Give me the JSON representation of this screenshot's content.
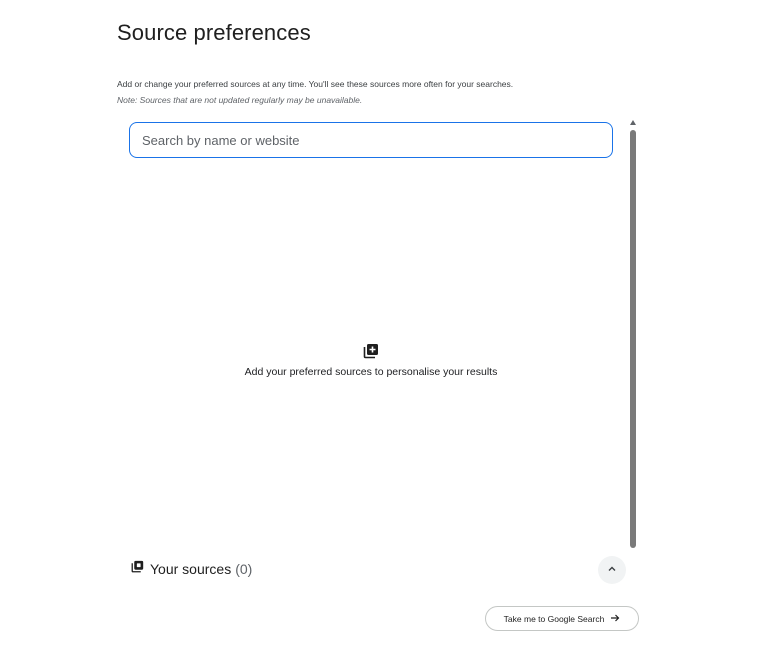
{
  "page": {
    "title": "Source preferences",
    "description": "Add or change your preferred sources at any time. You'll see these sources more often for your searches.",
    "note": "Note: Sources that are not updated regularly may be unavailable."
  },
  "search": {
    "placeholder": "Search by name or website",
    "value": ""
  },
  "empty_state": {
    "icon": "add-library-icon",
    "message": "Add your preferred sources to personalise your results"
  },
  "sources": {
    "icon": "library-icon",
    "label": "Your sources",
    "count": "(0)",
    "toggle_icon": "chevron-up-icon"
  },
  "cta": {
    "label": "Take me to Google Search",
    "icon": "arrow-right-icon"
  },
  "colors": {
    "accent": "#1a73e8",
    "text": "#1f1f1f",
    "muted": "#5f6368",
    "scrollbar": "#7a7a7a",
    "button_bg": "#f1f3f4"
  }
}
